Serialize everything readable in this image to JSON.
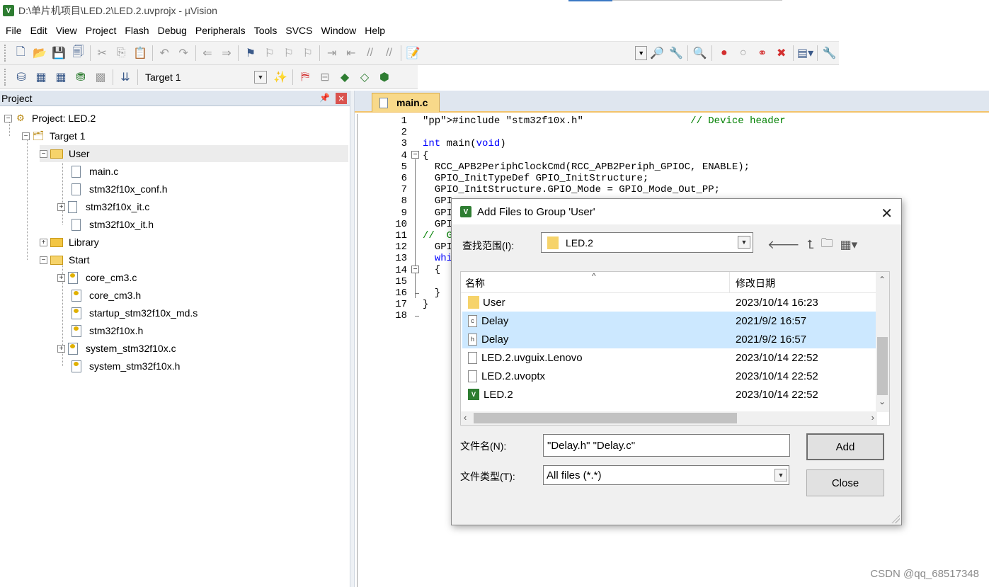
{
  "window": {
    "title": "D:\\单片机项目\\LED.2\\LED.2.uvprojx - µVision",
    "icon": "uv-icon"
  },
  "menu": [
    "File",
    "Edit",
    "View",
    "Project",
    "Flash",
    "Debug",
    "Peripherals",
    "Tools",
    "SVCS",
    "Window",
    "Help"
  ],
  "toolbar2": {
    "target_label": "Target 1"
  },
  "project_panel": {
    "title": "Project",
    "tree": [
      {
        "label": "Project: LED.2",
        "level": 0,
        "type": "project",
        "expanded": true
      },
      {
        "label": "Target 1",
        "level": 1,
        "type": "target",
        "expanded": true
      },
      {
        "label": "User",
        "level": 2,
        "type": "folder",
        "expanded": true,
        "selected": true
      },
      {
        "label": "main.c",
        "level": 3,
        "type": "file"
      },
      {
        "label": "stm32f10x_conf.h",
        "level": 3,
        "type": "file"
      },
      {
        "label": "stm32f10x_it.c",
        "level": 3,
        "type": "file",
        "has_children": true
      },
      {
        "label": "stm32f10x_it.h",
        "level": 3,
        "type": "file"
      },
      {
        "label": "Library",
        "level": 2,
        "type": "folder",
        "expanded": false
      },
      {
        "label": "Start",
        "level": 2,
        "type": "folder",
        "expanded": true
      },
      {
        "label": "core_cm3.c",
        "level": 3,
        "type": "keyfile",
        "has_children": true
      },
      {
        "label": "core_cm3.h",
        "level": 3,
        "type": "keyfile"
      },
      {
        "label": "startup_stm32f10x_md.s",
        "level": 3,
        "type": "keyfile"
      },
      {
        "label": "stm32f10x.h",
        "level": 3,
        "type": "keyfile"
      },
      {
        "label": "system_stm32f10x.c",
        "level": 3,
        "type": "keyfile",
        "has_children": true
      },
      {
        "label": "system_stm32f10x.h",
        "level": 3,
        "type": "keyfile"
      }
    ]
  },
  "editor": {
    "active_tab": "main.c",
    "line_numbers": [
      "1",
      "2",
      "3",
      "4",
      "5",
      "6",
      "7",
      "8",
      "9",
      "10",
      "11",
      "12",
      "13",
      "14",
      "15",
      "16",
      "17",
      "18"
    ],
    "lines": [
      "#include \"stm32f10x.h\"                  // Device header",
      "",
      "int main(void)",
      "{",
      "  RCC_APB2PeriphClockCmd(RCC_APB2Periph_GPIOC, ENABLE);",
      "  GPIO_InitTypeDef GPIO_InitStructure;",
      "  GPIO_InitStructure.GPIO_Mode = GPIO_Mode_Out_PP;",
      "  GPI",
      "  GPI",
      "  GPI",
      "//  G",
      "  GPI",
      "  whi",
      "  {",
      "",
      "  }",
      "}",
      ""
    ]
  },
  "dialog": {
    "title": "Add Files to Group 'User'",
    "look_in_label": "查找范围(I):",
    "look_in_value": "LED.2",
    "columns": {
      "name": "名称",
      "modified": "修改日期"
    },
    "files": [
      {
        "name": "User",
        "date": "2023/10/14 16:23",
        "icon": "folder-icon",
        "selected": false
      },
      {
        "name": "Delay",
        "date": "2021/9/2 16:57",
        "icon": "c-file-icon",
        "icon_letter": "c",
        "selected": true
      },
      {
        "name": "Delay",
        "date": "2021/9/2 16:57",
        "icon": "h-file-icon",
        "icon_letter": "h",
        "selected": true
      },
      {
        "name": "LED.2.uvguix.Lenovo",
        "date": "2023/10/14 22:52",
        "icon": "file-icon",
        "selected": false
      },
      {
        "name": "LED.2.uvoptx",
        "date": "2023/10/14 22:52",
        "icon": "file-icon",
        "selected": false
      },
      {
        "name": "LED.2",
        "date": "2023/10/14 22:52",
        "icon": "uvision-project-icon",
        "selected": false
      }
    ],
    "filename_label": "文件名(N):",
    "filename_value": "\"Delay.h\" \"Delay.c\"",
    "filetype_label": "文件类型(T):",
    "filetype_value": "All files (*.*)",
    "add_button": "Add",
    "close_button": "Close"
  },
  "watermark": "CSDN @qq_68517348"
}
